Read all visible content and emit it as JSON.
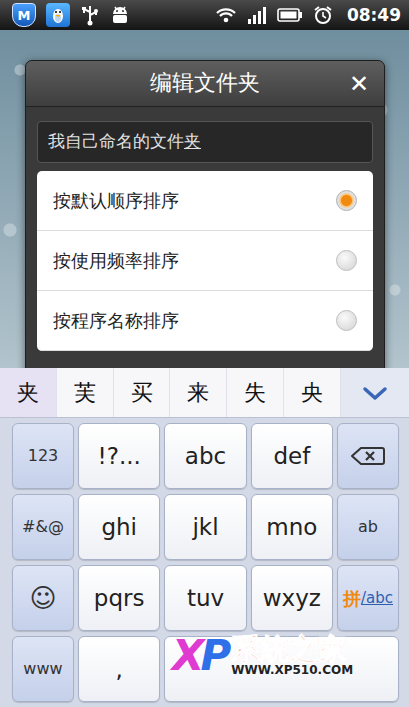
{
  "status_bar": {
    "badge": "M",
    "time": "08:49"
  },
  "dialog": {
    "title": "编辑文件夹",
    "close": "✕",
    "field": {
      "typed": "我自己命名的文件",
      "composing": "夹"
    },
    "options": [
      {
        "label": "按默认顺序排序",
        "selected": true
      },
      {
        "label": "按使用频率排序",
        "selected": false
      },
      {
        "label": "按程序名称排序",
        "selected": false
      }
    ]
  },
  "keyboard": {
    "candidates": [
      {
        "text": "夹",
        "selected": true
      },
      {
        "text": "芙",
        "selected": false
      },
      {
        "text": "买",
        "selected": false
      },
      {
        "text": "来",
        "selected": false
      },
      {
        "text": "失",
        "selected": false
      },
      {
        "text": "央",
        "selected": false
      }
    ],
    "rows": [
      [
        {
          "label": "123",
          "kind": "function"
        },
        {
          "label": "!?...",
          "kind": "letter"
        },
        {
          "label": "abc",
          "kind": "letter"
        },
        {
          "label": "def",
          "kind": "letter"
        },
        {
          "kind": "backspace"
        }
      ],
      [
        {
          "label": "#&@",
          "kind": "function"
        },
        {
          "label": "ghi",
          "kind": "letter"
        },
        {
          "label": "jkl",
          "kind": "letter"
        },
        {
          "label": "mno",
          "kind": "letter"
        },
        {
          "label": "ab",
          "kind": "function"
        }
      ],
      [
        {
          "label": "☺",
          "kind": "emoji"
        },
        {
          "label": "pqrs",
          "kind": "letter"
        },
        {
          "label": "tuv",
          "kind": "letter"
        },
        {
          "label": "wxyz",
          "kind": "letter"
        },
        {
          "kind": "lang",
          "parts": [
            "拼",
            "/abc"
          ]
        }
      ],
      [
        {
          "label": "www",
          "kind": "function"
        },
        {
          "label": ",",
          "kind": "letter"
        },
        {
          "kind": "space"
        }
      ]
    ]
  },
  "watermark": {
    "logo": [
      "X",
      "P"
    ],
    "name": "系統之家",
    "url": "WWW.XP510.COM"
  }
}
